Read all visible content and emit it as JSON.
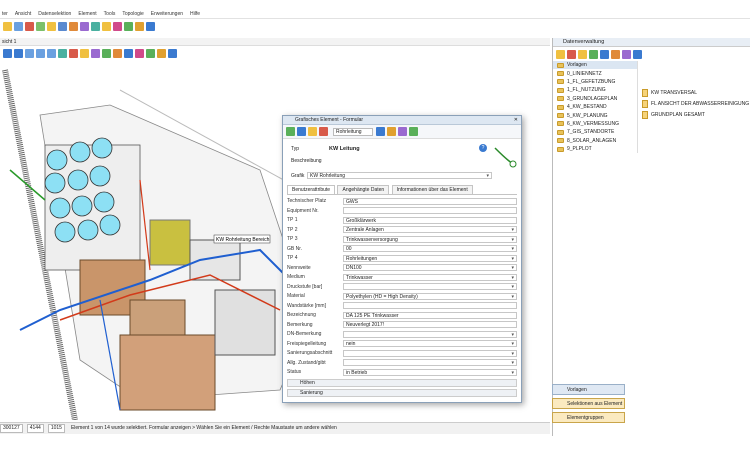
{
  "menu": [
    "ter",
    "Ansicht",
    "Datenselektion",
    "Element",
    "Tools",
    "Topologie",
    "Erweiterungen",
    "Hilfe"
  ],
  "tab_label": "sicht 1",
  "status": {
    "coord_x": "300127",
    "coord_y": "4144",
    "coord_z": "1015",
    "message": "Element 1 von 14 wurde selektiert. Formular anzeigen > Wählen Sie ein Element / Rechte Maustaste um andere wählen"
  },
  "drawing": {
    "label": "KW Rohrleitung Bereich"
  },
  "right_panel": {
    "title": "Datenverwaltung",
    "subheader": "Vorlagen",
    "tree": [
      "0_LINIENNETZ",
      "1_FL_GEFETZBUNG",
      "1_FL_NUTZUNG",
      "3_GRUNDLAGEPLAN",
      "4_KW_BESTAND",
      "5_KW_PLANUNG",
      "6_KW_VERMESSUNG",
      "7_GIS_STANDORTE",
      "8_SOLAR_ANLAGEN",
      "9_PLPLOT"
    ],
    "docs": [
      "KW TRANSVERSAL",
      "FL ANSICHT DER ABWASSERREINIGUNG",
      "GRUNDPLAN GESAMT"
    ],
    "btn_vorlagen": "Vorlagen",
    "btn_selektion": "Selektionen aus Element",
    "btn_elementgruppen": "Elementgruppen"
  },
  "dialog": {
    "title": "Grafisches Element - Formular",
    "toolbar_select": "Rohrleitung",
    "typ_label": "Typ",
    "typ_value": "KW Leitung",
    "beschreibung_label": "Beschreibung",
    "grafik_label": "Grafik",
    "grafik_value": "KW Rohrleitung",
    "tabs": [
      "Benutzerattribute",
      "Angehängte Daten",
      "Informationen über das Element"
    ],
    "fields": [
      {
        "label": "Technischer Platz",
        "value": "GWS",
        "dd": false
      },
      {
        "label": "Equipment Nr.",
        "value": "",
        "dd": false
      },
      {
        "label": "TP 1",
        "value": "Großklärwerk",
        "dd": false
      },
      {
        "label": "TP 2",
        "value": "Zentrale Anlagen",
        "dd": true
      },
      {
        "label": "TP 3",
        "value": "Trinkwasserversorgung",
        "dd": true
      },
      {
        "label": "GB Nr.",
        "value": "00",
        "dd": true
      },
      {
        "label": "TP 4",
        "value": "Rohrleitungen",
        "dd": true
      },
      {
        "label": "Nennweite",
        "value": "DN100",
        "dd": true
      },
      {
        "label": "Medium",
        "value": "Trinkwasser",
        "dd": true
      },
      {
        "label": "Druckstufe [bar]",
        "value": "",
        "dd": true
      },
      {
        "label": "Material",
        "value": "Polyethylen (HD = High Density)",
        "dd": true
      },
      {
        "label": "Wandstärke [mm]",
        "value": "",
        "dd": false
      },
      {
        "label": "Bezeichnung",
        "value": "DA 125 PE Trinkwasser",
        "dd": false
      },
      {
        "label": "Bemerkung",
        "value": "Neuverlegt 2017!",
        "dd": false
      },
      {
        "label": "DN-Bemerkung",
        "value": "",
        "dd": true
      },
      {
        "label": "Freispiegelleitung",
        "value": "nein",
        "dd": true
      },
      {
        "label": "Sanierungsabschnitt",
        "value": "",
        "dd": true
      },
      {
        "label": "Allg. Zustand/gibt",
        "value": "",
        "dd": true
      },
      {
        "label": "Status",
        "value": "in Betrieb",
        "dd": true
      }
    ],
    "section1": "Höhen",
    "section2": "Sanierung"
  },
  "colors": {
    "tank": "#8de0f4",
    "pipe_blue": "#1f5fd0",
    "pipe_red": "#d23a1a",
    "roof": "#c88a5a",
    "accent": "#f0c040"
  }
}
